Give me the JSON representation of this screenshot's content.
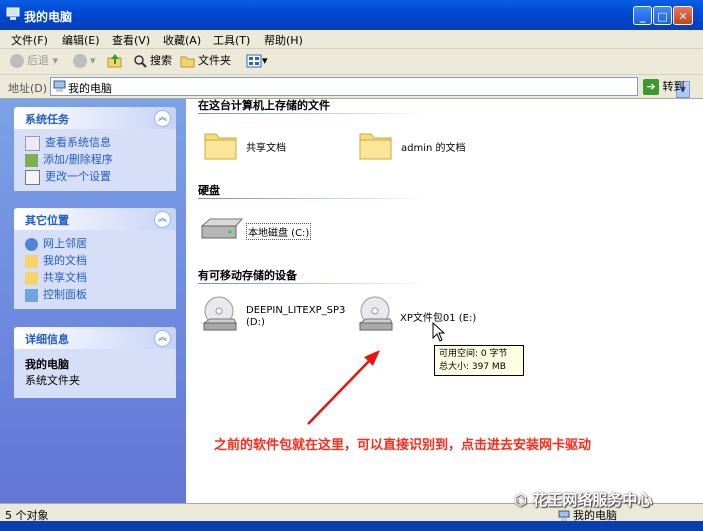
{
  "window": {
    "title": "我的电脑",
    "minimize": "_",
    "maximize": "□",
    "close": "✕"
  },
  "menu": [
    "文件(F)",
    "编辑(E)",
    "查看(V)",
    "收藏(A)",
    "工具(T)",
    "帮助(H)"
  ],
  "toolbar": {
    "back": "后退",
    "search": "搜索",
    "folders": "文件夹"
  },
  "address": {
    "label": "地址(D)",
    "value": "我的电脑",
    "go": "转到"
  },
  "sidebar": {
    "system_tasks": {
      "title": "系统任务",
      "items": [
        "查看系统信息",
        "添加/删除程序",
        "更改一个设置"
      ]
    },
    "other_places": {
      "title": "其它位置",
      "items": [
        "网上邻居",
        "我的文档",
        "共享文档",
        "控制面板"
      ]
    },
    "details": {
      "title": "详细信息",
      "name": "我的电脑",
      "type": "系统文件夹"
    }
  },
  "content": {
    "groups": [
      {
        "title": "在这台计算机上存储的文件",
        "items": [
          "共享文档",
          "admin 的文档"
        ]
      },
      {
        "title": "硬盘",
        "items": [
          "本地磁盘 (C:)"
        ]
      },
      {
        "title": "有可移动存储的设备",
        "items": [
          "DEEPIN_LITEXP_SP3",
          "(D:)",
          "XP文件包01 (E:)"
        ]
      }
    ]
  },
  "tooltip": {
    "line1": "可用空间: 0 字节",
    "line2": "总大小: 397 MB"
  },
  "annotation": "之前的软件包就在这里，可以直接识别到，点击进去安装网卡驱动",
  "status": {
    "left": "5 个对象",
    "right": "我的电脑"
  },
  "watermark": "花王网络服务中心",
  "colors": {
    "accent": "#215dc6",
    "annotation": "#ff2a18"
  }
}
